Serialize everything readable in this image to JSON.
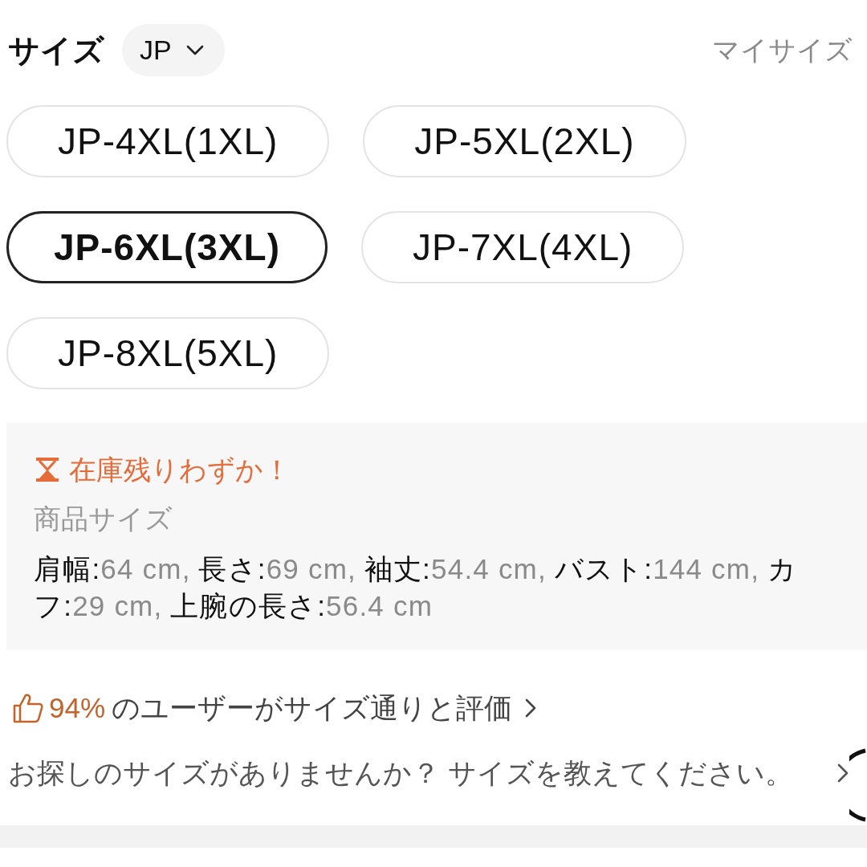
{
  "header": {
    "title": "サイズ",
    "region_selector": {
      "value": "JP"
    },
    "my_size_link": "マイサイズ"
  },
  "size_options": [
    {
      "label": "JP-4XL(1XL)",
      "selected": false
    },
    {
      "label": "JP-5XL(2XL)",
      "selected": false
    },
    {
      "label": "JP-6XL(3XL)",
      "selected": true
    },
    {
      "label": "JP-7XL(4XL)",
      "selected": false
    },
    {
      "label": "JP-8XL(5XL)",
      "selected": false
    }
  ],
  "stock_panel": {
    "warning": "在庫残りわずか！",
    "section_title": "商品サイズ",
    "measurement_lines": [
      [
        {
          "label": "肩幅:",
          "value": "64 cm,"
        },
        {
          "label": "長さ:",
          "value": "69 cm,"
        },
        {
          "label": "袖丈:",
          "value": "54.4 cm,"
        },
        {
          "label": "バスト:",
          "value": "144 cm,"
        },
        {
          "label": "カ"
        }
      ],
      [
        {
          "label": "フ:",
          "value": "29 cm,"
        },
        {
          "label": "上腕の長さ:",
          "value": "56.4 cm"
        }
      ]
    ]
  },
  "fit_rating": {
    "percent": "94%",
    "text": "のユーザーがサイズ通りと評価"
  },
  "size_request": {
    "text": "お探しのサイズがありませんか？ サイズを教えてください。"
  }
}
